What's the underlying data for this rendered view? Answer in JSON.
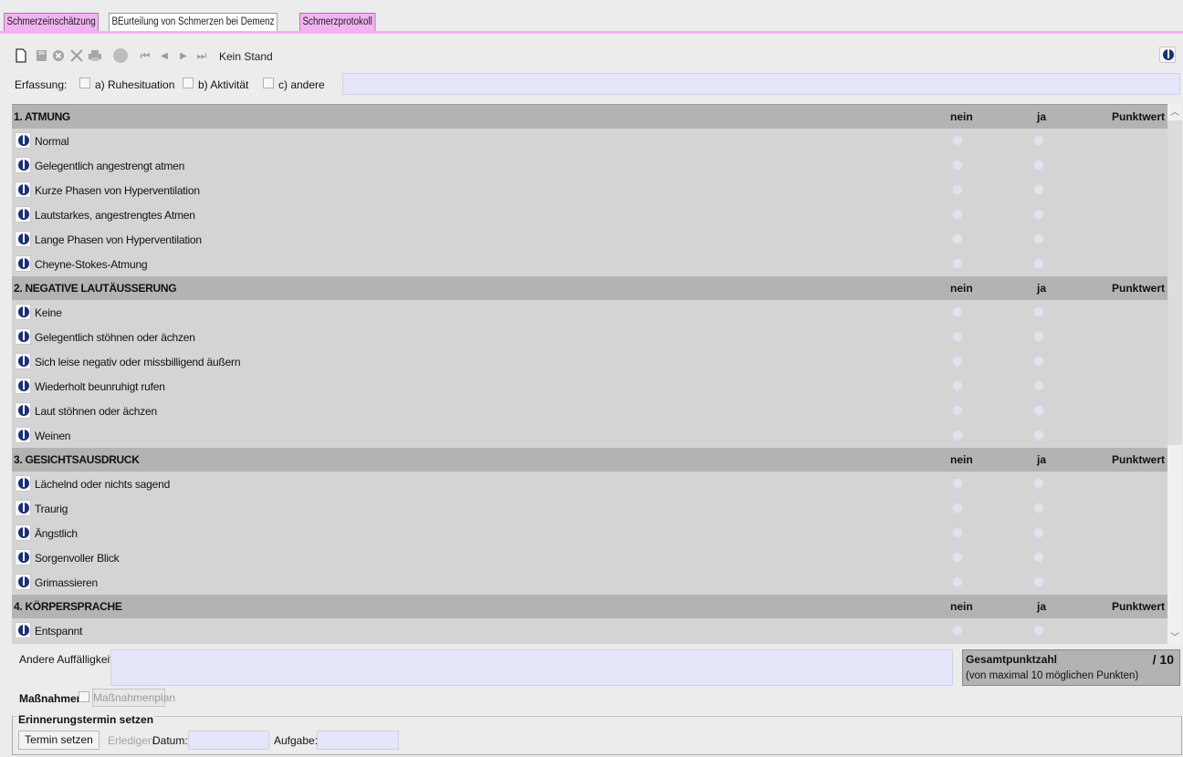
{
  "tabs": {
    "t1": "Schmerzeinschätzung",
    "t2": "BEurteilung von Schmerzen bei Demenz",
    "t3": "Schmerzprotokoll"
  },
  "toolbar": {
    "status": "Kein Stand"
  },
  "erfassung": {
    "label": "Erfassung:",
    "a": "a) Ruhesituation",
    "b": "b) Aktivität",
    "c": "c) andere"
  },
  "table": {
    "col_nein": "nein",
    "col_ja": "ja",
    "col_punkt": "Punktwert"
  },
  "sections": [
    {
      "title": "1. ATMUNG",
      "items": [
        "Normal",
        "Gelegentlich angestrengt atmen",
        "Kurze Phasen von Hyperventilation",
        "Lautstarkes, angestrengtes Atmen",
        "Lange Phasen von Hyperventilation",
        "Cheyne-Stokes-Atmung"
      ]
    },
    {
      "title": "2. NEGATIVE LAUTÄUSSERUNG",
      "items": [
        "Keine",
        "Gelegentlich stöhnen oder ächzen",
        "Sich leise negativ oder missbilligend äußern",
        "Wiederholt beunruhigt rufen",
        "Laut stöhnen oder ächzen",
        "Weinen"
      ]
    },
    {
      "title": "3. GESICHTSAUSDRUCK",
      "items": [
        "Lächelnd oder nichts sagend",
        "Traurig",
        "Ängstlich",
        "Sorgenvoller Blick",
        "Grimassieren"
      ]
    },
    {
      "title": "4. KÖRPERSPRACHE",
      "items": [
        "Entspannt"
      ]
    }
  ],
  "andere": {
    "label": "Andere Auffälligkeiten"
  },
  "gesamt": {
    "title": "Gesamtpunktzahl",
    "value": "/ 10",
    "sub": "(von maximal 10 möglichen Punkten)"
  },
  "massnahmen": {
    "label": "Maßnahmen:",
    "button": "Maßnahmenplan"
  },
  "erinnerung": {
    "legend": "Erinnerungstermin setzen",
    "termin": "Termin setzen",
    "erledigen": "Erledigen",
    "datum": "Datum:",
    "aufgabe": "Aufgabe:"
  },
  "colors": {
    "tab": "#f1b3f1",
    "input": "#e6e6fa",
    "header": "#b3b3b3",
    "row": "#d4d4d4",
    "info": "#1c2f74"
  }
}
